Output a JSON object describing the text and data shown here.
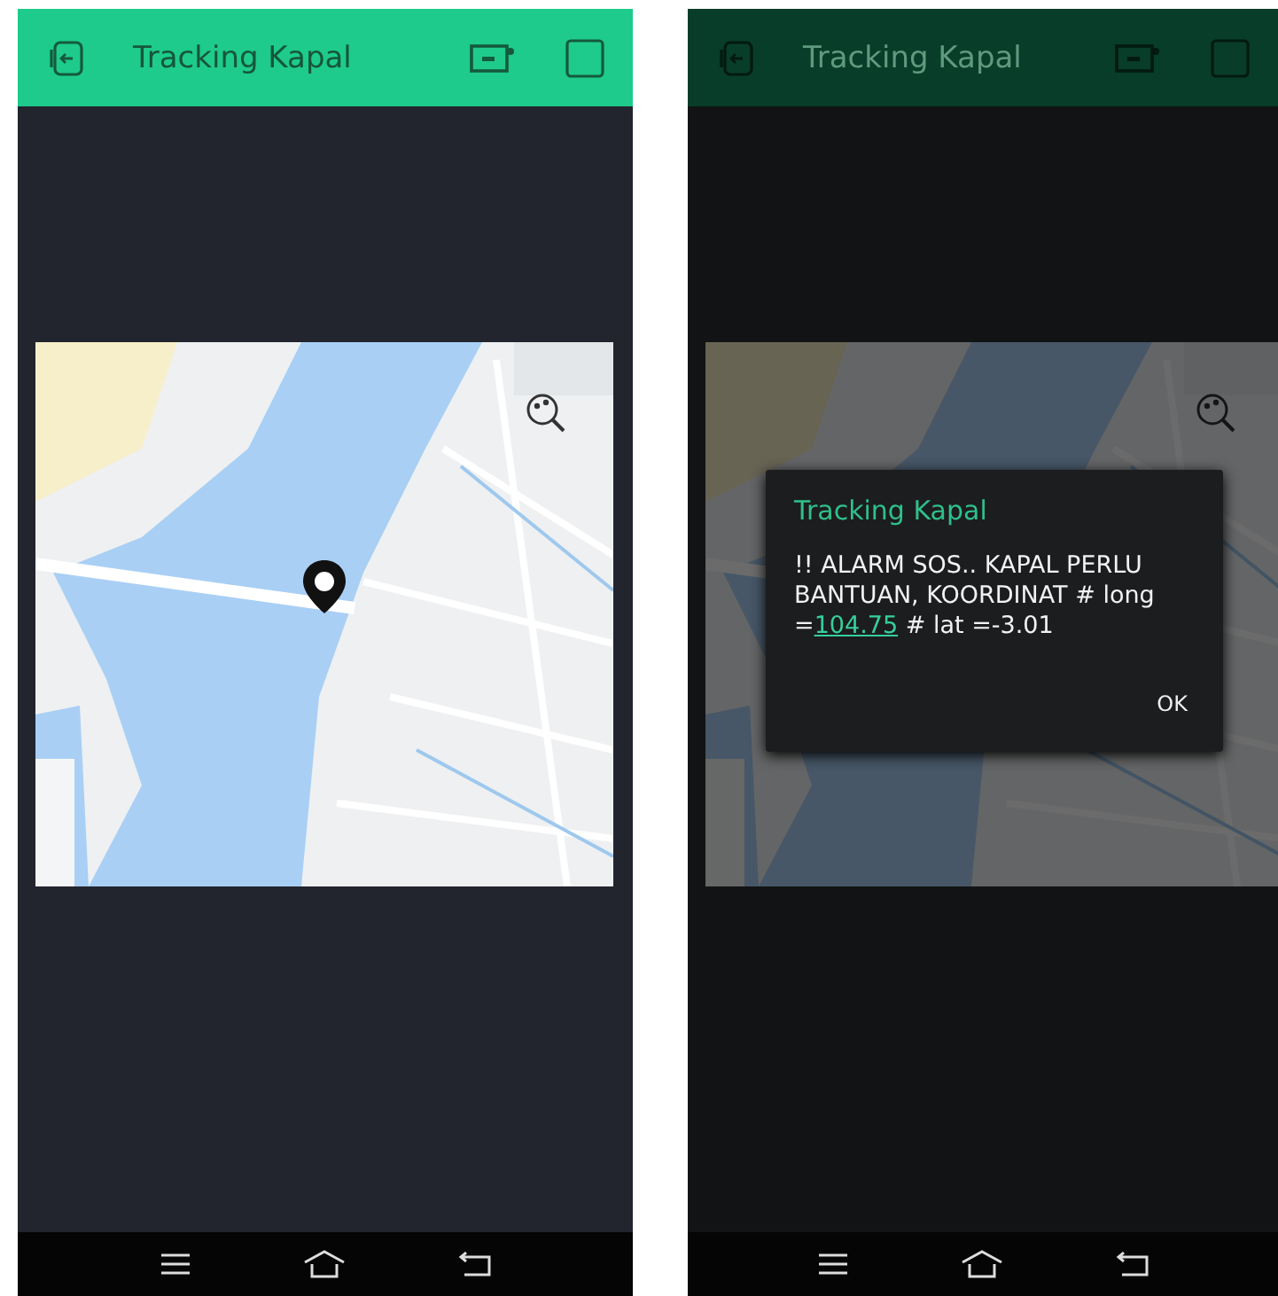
{
  "phones": [
    {
      "header": {
        "title": "Tracking Kapal"
      },
      "dimmed": false
    },
    {
      "header": {
        "title": "Tracking Kapal"
      },
      "dimmed": true,
      "dialog": {
        "title": "Tracking Kapal",
        "text_before": "!! ALARM SOS.. KAPAL PERLU BANTUAN, KOORDINAT # long =",
        "link": "104.75",
        "text_after": " # lat =-3.01",
        "button": "OK"
      }
    }
  ]
}
